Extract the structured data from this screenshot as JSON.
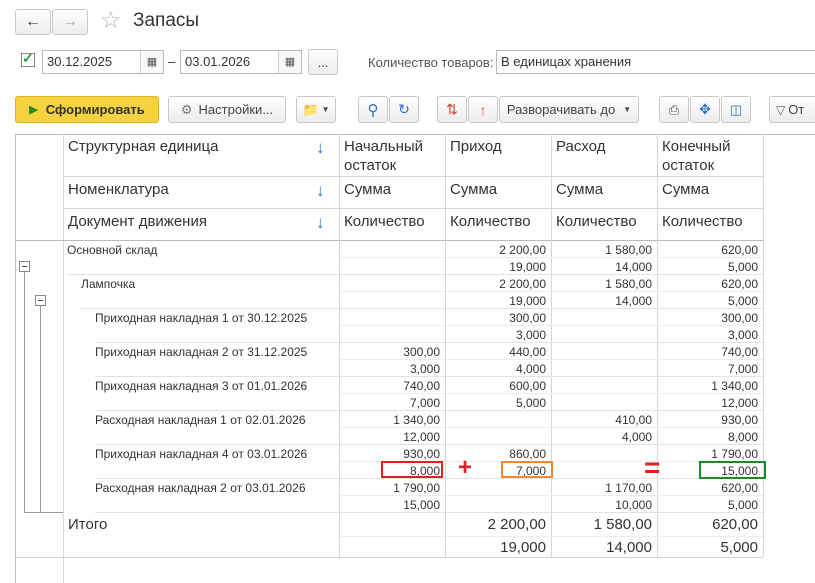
{
  "window": {
    "title": "Запасы"
  },
  "filter": {
    "date_from": "30.12.2025",
    "date_to": "03.01.2026",
    "dash": "–",
    "more": "...",
    "qty_label": "Количество товаров:",
    "qty_value": "В единицах хранения"
  },
  "toolbar": {
    "generate_label": "Сформировать",
    "settings_label": "Настройки...",
    "expand_label": "Разворачивать до",
    "extra_label": "От"
  },
  "columns": {
    "group_headers": [
      "Структурная единица",
      "Номенклатура",
      "Документ движения"
    ],
    "start": "Начальный остаток",
    "income": "Приход",
    "expense": "Расход",
    "end": "Конечный остаток",
    "sum": "Сумма",
    "qty": "Количество"
  },
  "rows": [
    {
      "label": "Основной склад",
      "sum": [
        "",
        "2 200,00",
        "1 580,00",
        "620,00"
      ],
      "qty": [
        "",
        "19,000",
        "14,000",
        "5,000"
      ]
    },
    {
      "label": "Лампочка",
      "sum": [
        "",
        "2 200,00",
        "1 580,00",
        "620,00"
      ],
      "qty": [
        "",
        "19,000",
        "14,000",
        "5,000"
      ]
    },
    {
      "label": "Приходная накладная 1 от 30.12.2025",
      "sum": [
        "",
        "300,00",
        "",
        "300,00"
      ],
      "qty": [
        "",
        "3,000",
        "",
        "3,000"
      ]
    },
    {
      "label": "Приходная накладная 2 от 31.12.2025",
      "sum": [
        "300,00",
        "440,00",
        "",
        "740,00"
      ],
      "qty": [
        "3,000",
        "4,000",
        "",
        "7,000"
      ]
    },
    {
      "label": "Приходная накладная 3 от 01.01.2026",
      "sum": [
        "740,00",
        "600,00",
        "",
        "1 340,00"
      ],
      "qty": [
        "7,000",
        "5,000",
        "",
        "12,000"
      ]
    },
    {
      "label": "Расходная накладная 1 от 02.01.2026",
      "sum": [
        "1 340,00",
        "",
        "410,00",
        "930,00"
      ],
      "qty": [
        "12,000",
        "",
        "4,000",
        "8,000"
      ]
    },
    {
      "label": "Приходная накладная 4 от 03.01.2026",
      "sum": [
        "930,00",
        "860,00",
        "",
        "1 790,00"
      ],
      "qty": [
        "8,000",
        "7,000",
        "",
        "15,000"
      ]
    },
    {
      "label": "Расходная накладная 2 от 03.01.2026",
      "sum": [
        "1 790,00",
        "",
        "1 170,00",
        "620,00"
      ],
      "qty": [
        "15,000",
        "",
        "10,000",
        "5,000"
      ]
    }
  ],
  "total": {
    "label": "Итого",
    "sum": [
      "",
      "2 200,00",
      "1 580,00",
      "620,00"
    ],
    "qty": [
      "",
      "19,000",
      "14,000",
      "5,000"
    ]
  },
  "annotation": {
    "plus": "+",
    "equals": "="
  },
  "colors": {
    "accent_yellow": "#f5d33f",
    "red": "#e02020",
    "orange": "#f0883a",
    "green": "#1a8a2a",
    "blue_arrow": "#2b73c7"
  }
}
